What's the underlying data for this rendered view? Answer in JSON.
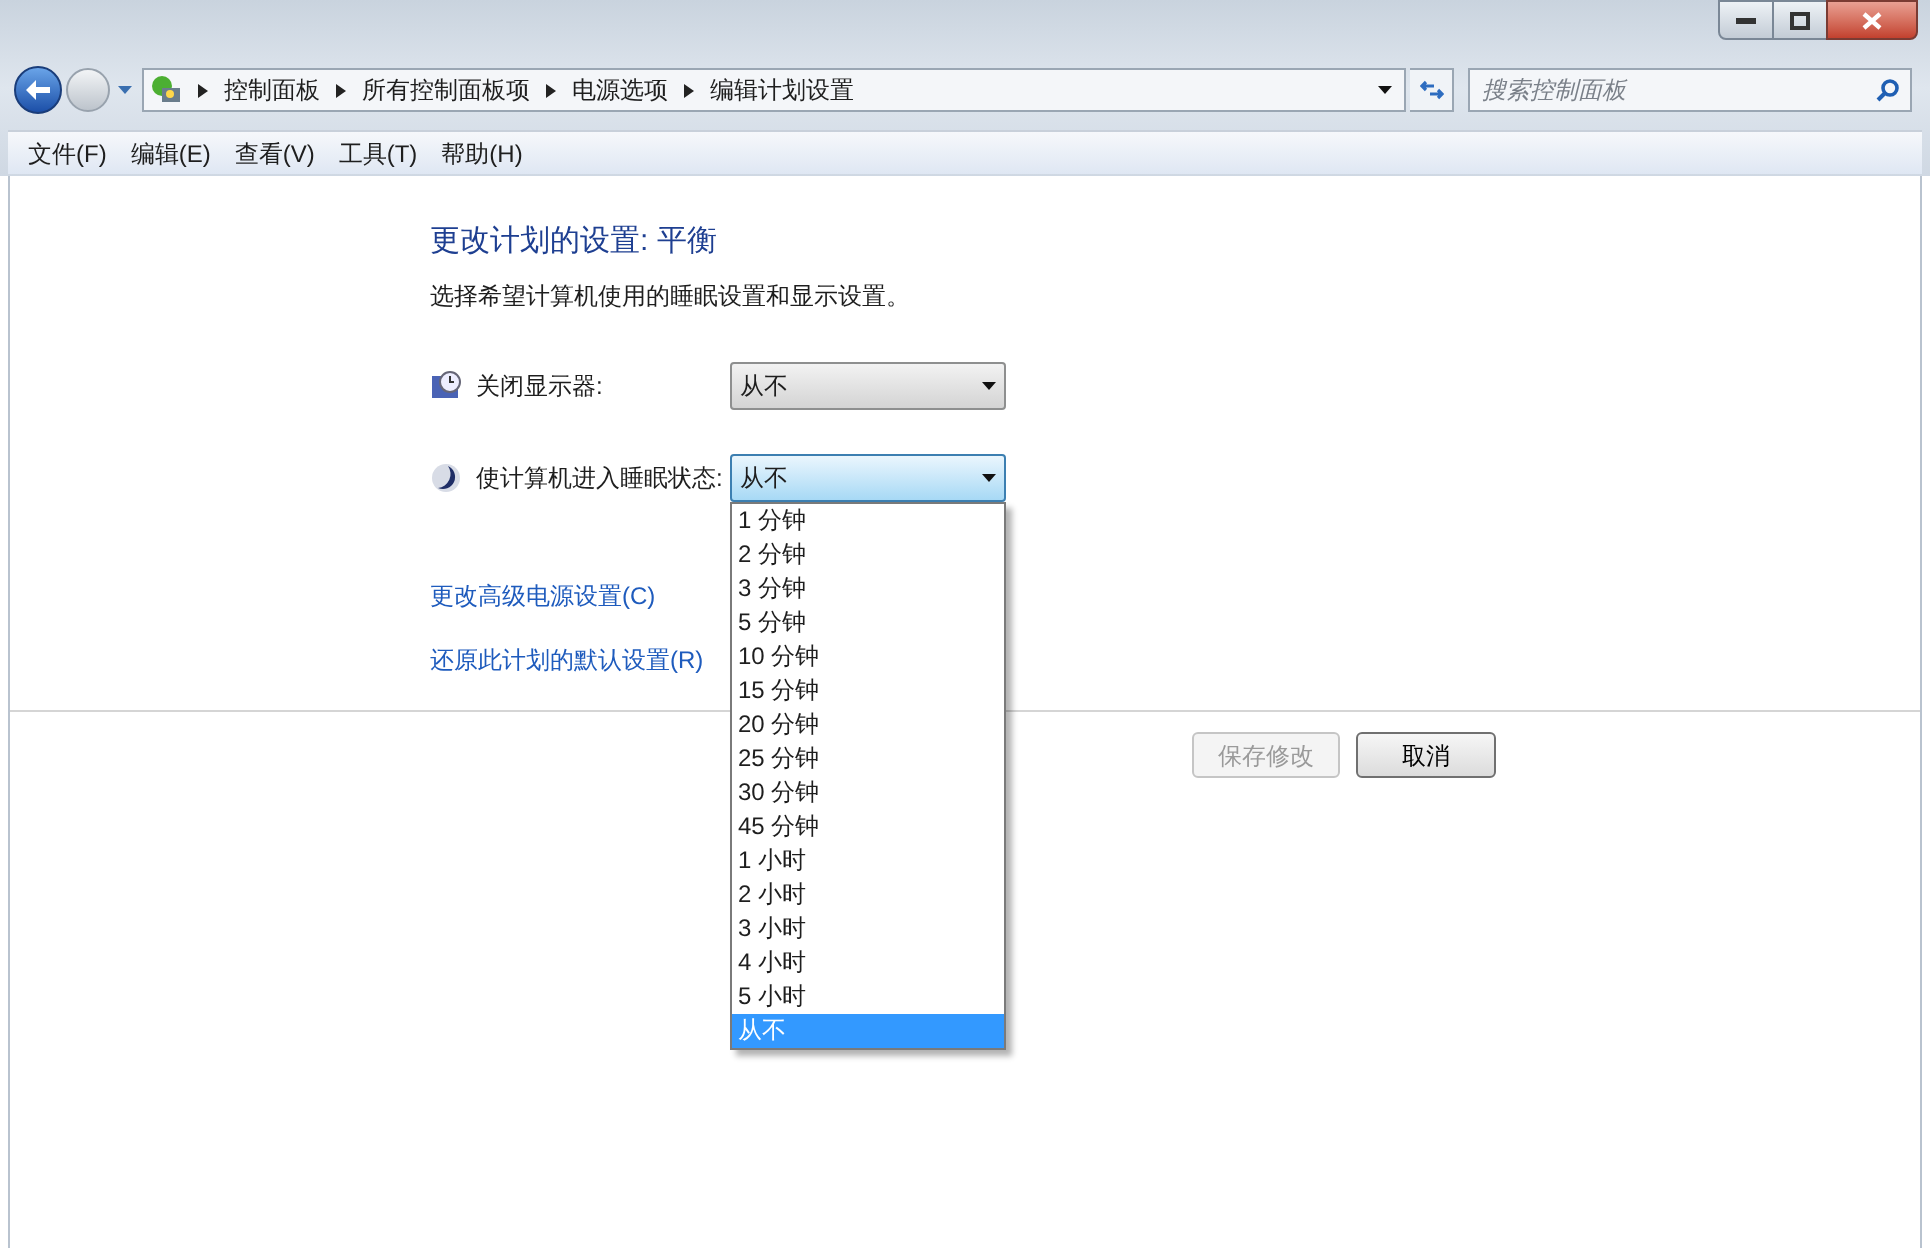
{
  "breadcrumb": [
    "控制面板",
    "所有控制面板项",
    "电源选项",
    "编辑计划设置"
  ],
  "search": {
    "placeholder": "搜索控制面板"
  },
  "menu": [
    "文件(F)",
    "编辑(E)",
    "查看(V)",
    "工具(T)",
    "帮助(H)"
  ],
  "heading": "更改计划的设置: 平衡",
  "subtitle": "选择希望计算机使用的睡眠设置和显示设置。",
  "settings": [
    {
      "kind": "display",
      "label": "关闭显示器:",
      "value": "从不",
      "expanded": false
    },
    {
      "kind": "sleep",
      "label": "使计算机进入睡眠状态:",
      "value": "从不",
      "expanded": true
    }
  ],
  "options": [
    {
      "label": "1 分钟",
      "selected": false
    },
    {
      "label": "2 分钟",
      "selected": false
    },
    {
      "label": "3 分钟",
      "selected": false
    },
    {
      "label": "5 分钟",
      "selected": false
    },
    {
      "label": "10 分钟",
      "selected": false
    },
    {
      "label": "15 分钟",
      "selected": false
    },
    {
      "label": "20 分钟",
      "selected": false
    },
    {
      "label": "25 分钟",
      "selected": false
    },
    {
      "label": "30 分钟",
      "selected": false
    },
    {
      "label": "45 分钟",
      "selected": false
    },
    {
      "label": "1 小时",
      "selected": false
    },
    {
      "label": "2 小时",
      "selected": false
    },
    {
      "label": "3 小时",
      "selected": false
    },
    {
      "label": "4 小时",
      "selected": false
    },
    {
      "label": "5 小时",
      "selected": false
    },
    {
      "label": "从不",
      "selected": true
    }
  ],
  "links": [
    "更改高级电源设置(C)",
    "还原此计划的默认设置(R)"
  ],
  "buttons": [
    {
      "label": "保存修改",
      "disabled": true
    },
    {
      "label": "取消",
      "disabled": false
    }
  ]
}
